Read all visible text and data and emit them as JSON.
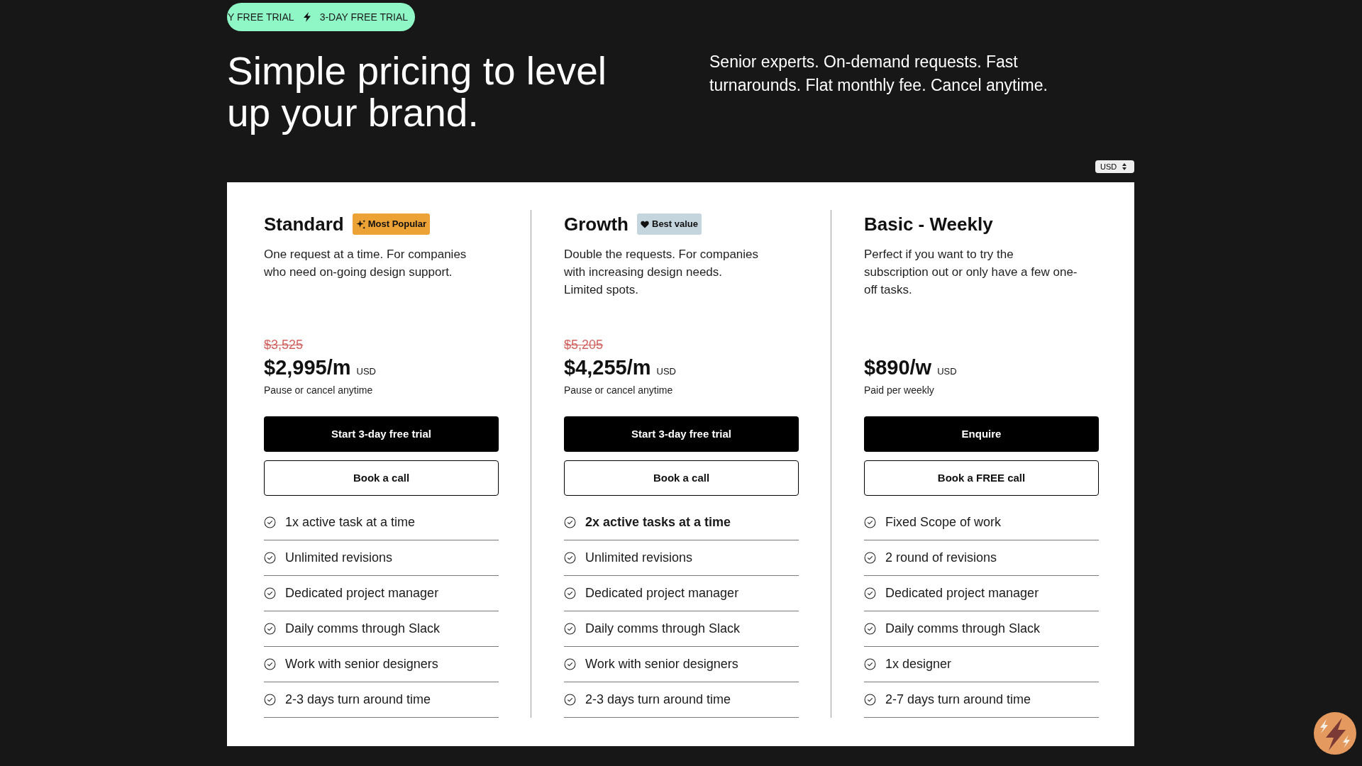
{
  "promo_banner": {
    "items": [
      "Y FREE TRIAL",
      "3-DAY FREE TRIAL"
    ]
  },
  "hero": {
    "title": "Simple pricing to level up your brand.",
    "subtitle": "Senior experts. On-demand requests. Fast turnarounds. Flat monthly fee. Cancel anytime."
  },
  "currency_select": {
    "value": "USD"
  },
  "plans": [
    {
      "name": "Standard",
      "badge": {
        "kind": "popular",
        "label": "Most Popular"
      },
      "description": "One request at a time. For companies\nwho need on-going design support.",
      "old_price": "$3,525",
      "price": "$2,995/m",
      "currency": "USD",
      "price_note": "Pause or cancel anytime",
      "primary_button": "Start 3-day free trial",
      "secondary_button": "Book a call",
      "features": [
        {
          "text": "1x active task at a time",
          "bold": false
        },
        {
          "text": "Unlimited revisions",
          "bold": false
        },
        {
          "text": "Dedicated project manager",
          "bold": false
        },
        {
          "text": "Daily comms through Slack",
          "bold": false
        },
        {
          "text": "Work with senior designers",
          "bold": false
        },
        {
          "text": "2-3 days turn around time",
          "bold": false
        }
      ]
    },
    {
      "name": "Growth",
      "badge": {
        "kind": "value",
        "label": "Best value"
      },
      "description": "Double the requests. For companies\nwith increasing design needs.\nLimited spots.",
      "old_price": "$5,205",
      "price": "$4,255/m",
      "currency": "USD",
      "price_note": "Pause or cancel anytime",
      "primary_button": "Start 3-day free trial",
      "secondary_button": "Book a call",
      "features": [
        {
          "text": "2x active tasks at a time",
          "bold": true
        },
        {
          "text": "Unlimited revisions",
          "bold": false
        },
        {
          "text": "Dedicated project manager",
          "bold": false
        },
        {
          "text": "Daily comms through Slack",
          "bold": false
        },
        {
          "text": "Work with senior designers",
          "bold": false
        },
        {
          "text": "2-3 days turn around time",
          "bold": false
        }
      ]
    },
    {
      "name": "Basic - Weekly",
      "description": "Perfect if you want to try the\nsubscription out or only have a few one-\noff tasks.",
      "price": "$890/w",
      "currency": "USD",
      "price_note": "Paid per weekly",
      "primary_button": "Enquire",
      "secondary_button": "Book a FREE call",
      "features": [
        {
          "text": "Fixed Scope of work",
          "bold": false
        },
        {
          "text": "2 round of revisions",
          "bold": false
        },
        {
          "text": "Dedicated project manager",
          "bold": false
        },
        {
          "text": "Daily comms through Slack",
          "bold": false
        },
        {
          "text": "1x designer",
          "bold": false
        },
        {
          "text": "2-7 days turn around time",
          "bold": false
        }
      ]
    }
  ]
}
